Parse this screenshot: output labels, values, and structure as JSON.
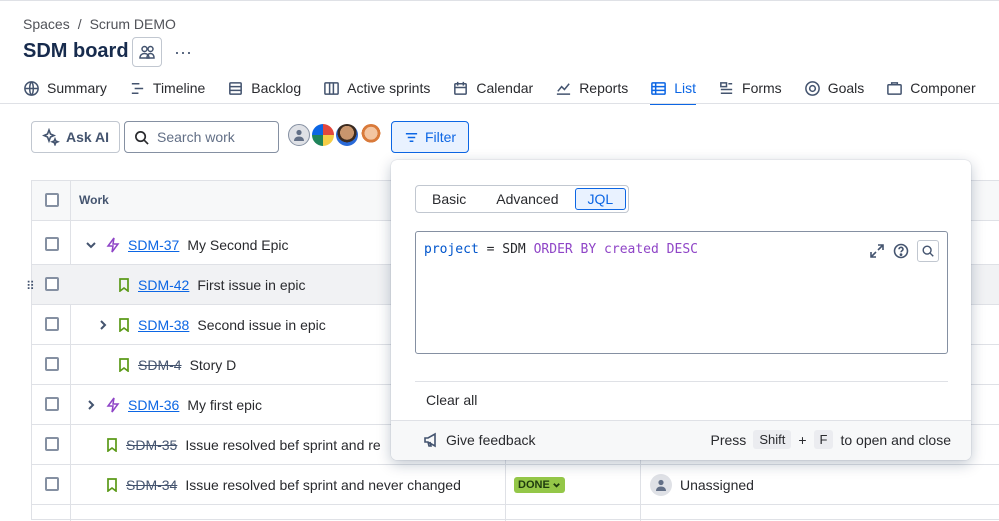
{
  "breadcrumb": {
    "space": "Spaces",
    "sep": "/",
    "project": "Scrum DEMO"
  },
  "board": {
    "title": "SDM board",
    "more": "···"
  },
  "tabs": [
    {
      "label": "Summary",
      "icon": "globe-icon"
    },
    {
      "label": "Timeline",
      "icon": "timeline-icon"
    },
    {
      "label": "Backlog",
      "icon": "backlog-icon"
    },
    {
      "label": "Active sprints",
      "icon": "board-icon"
    },
    {
      "label": "Calendar",
      "icon": "calendar-icon"
    },
    {
      "label": "Reports",
      "icon": "chart-icon"
    },
    {
      "label": "List",
      "icon": "list-icon",
      "active": true
    },
    {
      "label": "Forms",
      "icon": "forms-icon"
    },
    {
      "label": "Goals",
      "icon": "target-icon"
    },
    {
      "label": "Componer",
      "icon": "component-icon"
    }
  ],
  "toolbar": {
    "ask_ai": "Ask AI",
    "search_placeholder": "Search work",
    "filter": "Filter"
  },
  "table": {
    "column_work": "Work",
    "rows": [
      {
        "key": "SDM-37",
        "summary": "My Second Epic",
        "type": "epic",
        "expand": "down",
        "done": false
      },
      {
        "key": "SDM-42",
        "summary": "First issue in epic",
        "type": "story",
        "expand": "",
        "done": false
      },
      {
        "key": "SDM-38",
        "summary": "Second issue in epic",
        "type": "story",
        "expand": "right",
        "done": false
      },
      {
        "key": "SDM-4",
        "summary": "Story D",
        "type": "story",
        "expand": "",
        "done": true
      },
      {
        "key": "SDM-36",
        "summary": "My first epic",
        "type": "epic",
        "expand": "right",
        "done": false
      },
      {
        "key": "SDM-35",
        "summary": "Issue resolved bef sprint and re",
        "type": "story",
        "expand": "",
        "done": true
      },
      {
        "key": "SDM-34",
        "summary": "Issue resolved bef sprint and never changed",
        "type": "story",
        "expand": "",
        "done": true,
        "status": "DONE",
        "assignee": "Unassigned"
      }
    ]
  },
  "filter_popup": {
    "modes": [
      "Basic",
      "Advanced",
      "JQL"
    ],
    "selected_mode": "JQL",
    "jql": {
      "field": "project",
      "op": "=",
      "value": "SDM",
      "kw1": "ORDER BY",
      "field2": "created",
      "kw2": "DESC"
    },
    "clear_all": "Clear all",
    "feedback": "Give feedback",
    "hint_press": "Press",
    "hint_key1": "Shift",
    "hint_plus": "+",
    "hint_key2": "F",
    "hint_tail": "to open and close"
  },
  "colors": {
    "accent": "#0c66e4",
    "epic": "#8f45c7",
    "story": "#5b9a18",
    "done_badge": "#94c748"
  }
}
